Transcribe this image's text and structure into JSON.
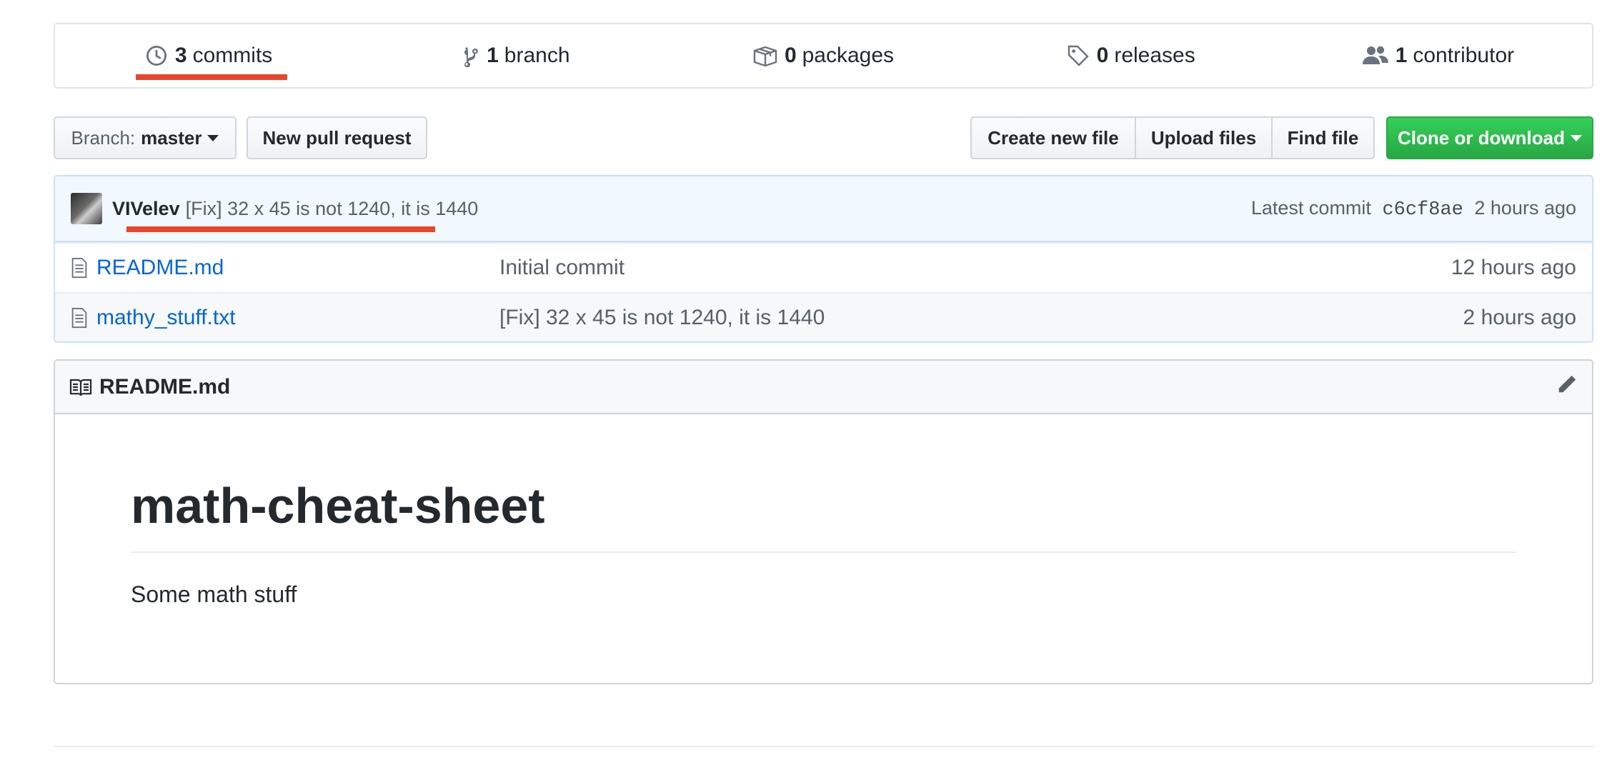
{
  "summary": {
    "commits": {
      "count": "3",
      "label": "commits",
      "icon": "history-icon"
    },
    "branches": {
      "count": "1",
      "label": "branch",
      "icon": "git-branch-icon"
    },
    "packages": {
      "count": "0",
      "label": "packages",
      "icon": "package-icon"
    },
    "releases": {
      "count": "0",
      "label": "releases",
      "icon": "tag-icon"
    },
    "contributors": {
      "count": "1",
      "label": "contributor",
      "icon": "people-icon"
    }
  },
  "toolbar": {
    "branch_prefix": "Branch:",
    "branch_name": "master",
    "new_pull_request": "New pull request",
    "create_new_file": "Create new file",
    "upload_files": "Upload files",
    "find_file": "Find file",
    "clone_or_download": "Clone or download"
  },
  "latest_commit": {
    "author": "VIVelev",
    "message": "[Fix] 32 x 45 is not 1240, it is 1440",
    "label": "Latest commit",
    "sha": "c6cf8ae",
    "age": "2 hours ago"
  },
  "files": [
    {
      "name": "README.md",
      "message": "Initial commit",
      "age": "12 hours ago",
      "icon": "file-icon"
    },
    {
      "name": "mathy_stuff.txt",
      "message": "[Fix] 32 x 45 is not 1240, it is 1440",
      "age": "2 hours ago",
      "icon": "file-icon"
    }
  ],
  "readme": {
    "filename": "README.md",
    "title": "math-cheat-sheet",
    "body": "Some math stuff"
  },
  "colors": {
    "annotation_red": "#e8452c",
    "link_blue": "#0366d6",
    "clone_green": "#28a745",
    "commit_bg": "#f1f8ff"
  }
}
